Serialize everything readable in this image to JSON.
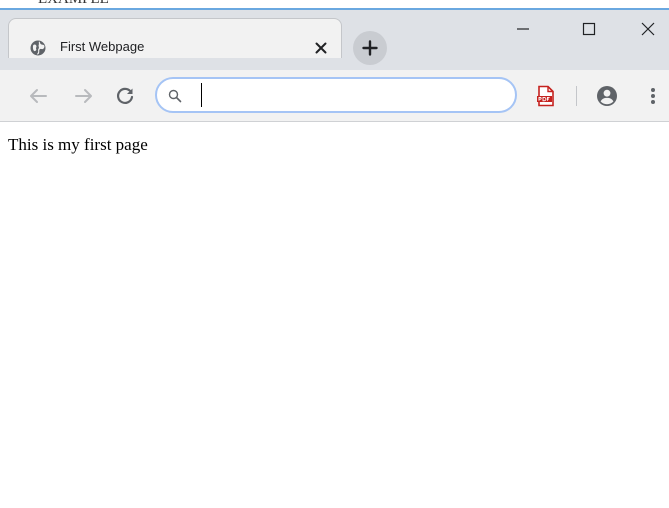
{
  "window": {
    "background_text": "EXAMPLE"
  },
  "tab": {
    "title": "First Webpage",
    "favicon": "globe-icon",
    "close_icon": "close-icon"
  },
  "new_tab": {
    "icon": "plus-icon"
  },
  "window_controls": {
    "minimize_icon": "minimize-icon",
    "maximize_icon": "maximize-icon",
    "close_icon": "close-icon"
  },
  "toolbar": {
    "back_icon": "arrow-left-icon",
    "forward_icon": "arrow-right-icon",
    "reload_icon": "reload-icon",
    "omnibox": {
      "value": "",
      "search_icon": "search-icon"
    },
    "extension_icon": "pdf-icon",
    "profile_icon": "account-circle-icon",
    "menu_icon": "more-vertical-icon"
  },
  "page": {
    "text": "This is my first page"
  },
  "colors": {
    "titlebar": "#dee1e6",
    "toolbar": "#f2f2f2",
    "omnibox_border": "#a5c4f5",
    "pdf_red": "#c5221f",
    "window_border": "#6aa8e0"
  }
}
